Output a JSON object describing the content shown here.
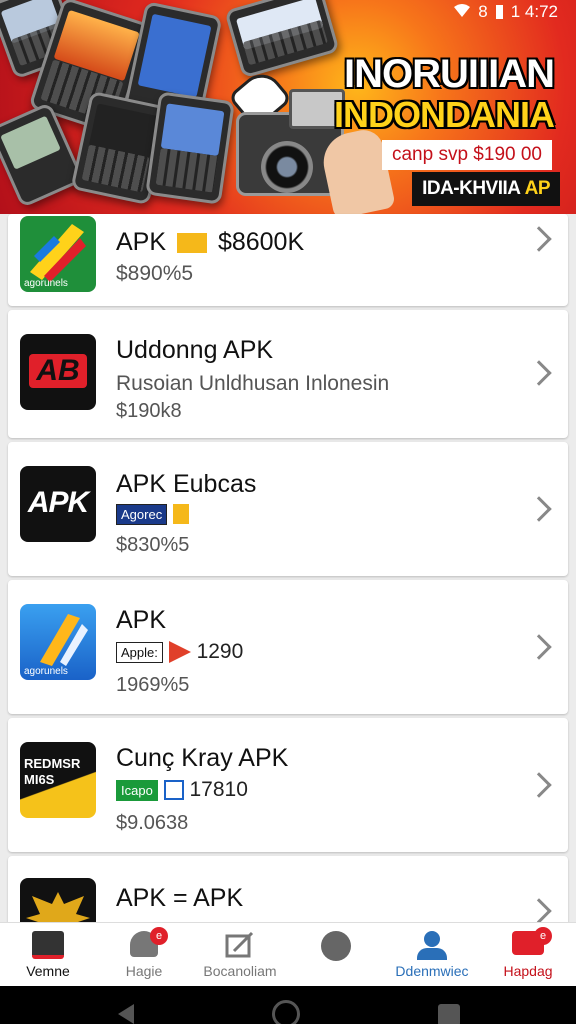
{
  "status_bar": {
    "signal": "8",
    "time": "1 4:72"
  },
  "banner": {
    "title": "INORUIIIAN",
    "subtitle": "INDONDANIA",
    "price": "canp svp $190 00",
    "tag_main": "IDA-KHVIIA",
    "tag_accent": "AP"
  },
  "apps": [
    {
      "name": "APK",
      "badge": "$8600K",
      "line2": "$890%5",
      "line3": "",
      "icon_text": "agorunels",
      "icon": "colorful-x-icon"
    },
    {
      "name": "Uddonng APK",
      "badge": "",
      "line2": "Rusoian Unldhusan Inlonesin",
      "line3": "$190k8",
      "icon_text": "AB",
      "icon": "ab-logo-icon"
    },
    {
      "name": "APK Eubcas",
      "badge": "Agorec",
      "line2": "",
      "line3": "$830%5",
      "icon_text": "APK",
      "icon": "apk-logo-icon"
    },
    {
      "name": "APK",
      "badge": "Apple:",
      "badge_extra": "1290",
      "line2": "",
      "line3": "1969%5",
      "icon_text": "agorunels",
      "icon": "blue-slash-icon"
    },
    {
      "name": "Cunç Kray APK",
      "badge": "Icapo",
      "badge_extra": "17810",
      "line2": "",
      "line3": "$9.0638",
      "icon_text": "REDMSR MI6S",
      "icon": "redmsr-icon"
    },
    {
      "name": "APK = APK",
      "badge": "",
      "line2": "",
      "line3": "",
      "icon_text": "",
      "icon": "eagle-icon"
    }
  ],
  "nav": [
    {
      "label": "Vemne",
      "icon": "home-icon",
      "active": true,
      "badge": ""
    },
    {
      "label": "Hagie",
      "icon": "bell-icon",
      "active": false,
      "badge": "e"
    },
    {
      "label": "Bocanoliam",
      "icon": "edit-icon",
      "active": false,
      "badge": ""
    },
    {
      "label": "",
      "icon": "globe-icon",
      "active": false,
      "badge": ""
    },
    {
      "label": "Ddenmwiec",
      "icon": "profile-icon",
      "active": false,
      "badge": ""
    },
    {
      "label": "Hapdag",
      "icon": "message-icon",
      "active": false,
      "badge": "e"
    }
  ]
}
